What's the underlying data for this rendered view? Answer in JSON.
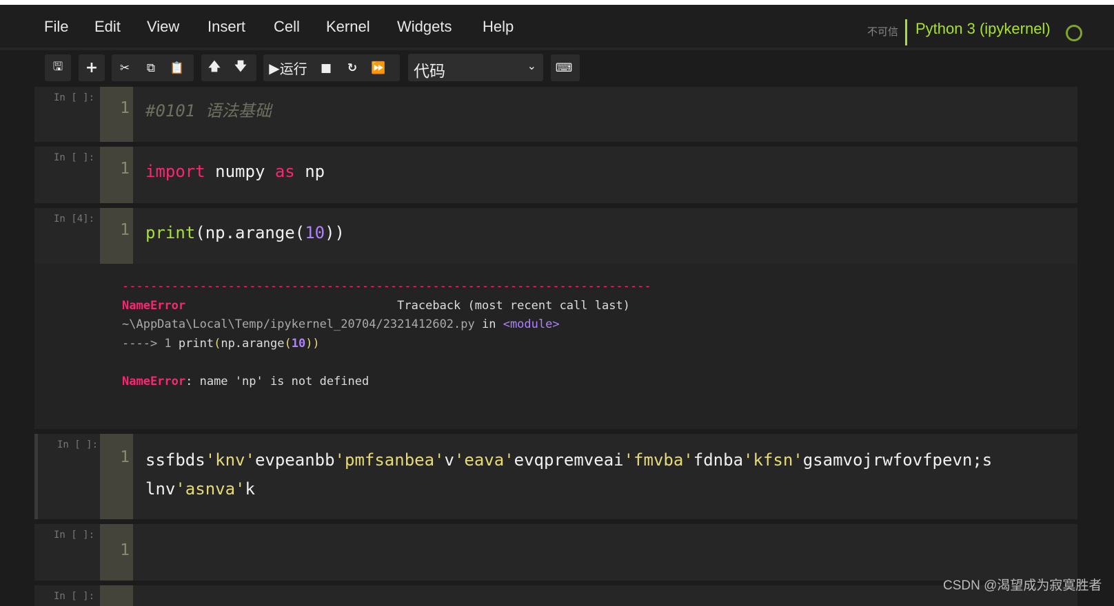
{
  "menu": [
    "File",
    "Edit",
    "View",
    "Insert",
    "Cell",
    "Kernel",
    "Widgets",
    "Help"
  ],
  "kernel": {
    "trust": "不可信",
    "name": "Python 3 (ipykernel)",
    "status_icon": "kernel-idle-circle"
  },
  "toolbar": {
    "run_label": "运行",
    "cell_type": "代码"
  },
  "cells": [
    {
      "prompt": "In [ ]:",
      "line": "1",
      "code": "#0101 语法基础"
    },
    {
      "prompt": "In [ ]:",
      "line": "1",
      "code_kw1": "import",
      "code_mid": " numpy ",
      "code_kw2": "as",
      "code_end": " np"
    },
    {
      "prompt": "In [4]:",
      "line": "1",
      "code_fn": "print",
      "code_a": "(np.arange(",
      "code_num": "10",
      "code_b": "))"
    },
    {
      "prompt": "In [ ]:",
      "line": "1",
      "segments": [
        "ssfbds",
        "'knv'",
        "evpeanbb",
        "'pmfsanbea'",
        "v",
        "'eava'",
        "evqpremveai",
        "'fmvba'",
        "fdnba",
        "'kfsn'",
        "gsamvojrwfovfpevn;s\nlnv",
        "'asnva'",
        "k"
      ]
    },
    {
      "prompt": "In [ ]:",
      "line": "1"
    },
    {
      "prompt": "In [ ]:"
    }
  ],
  "output": {
    "dashes": "---------------------------------------------------------------------------",
    "err_name": "NameError",
    "traceback": "                              Traceback (most recent call last)",
    "path": "~\\AppData\\Local\\Temp/ipykernel_20704/2321412602.py",
    "in": " in ",
    "module": "<module>",
    "arrow": "----> 1 ",
    "line_fn": "print",
    "line_a": "(",
    "line_b": "np.arange",
    "line_c": "(",
    "line_num": "10",
    "line_d": "))",
    "err_msg": ": name 'np' is not defined"
  },
  "watermark": "CSDN @渴望成为寂寞胜者"
}
